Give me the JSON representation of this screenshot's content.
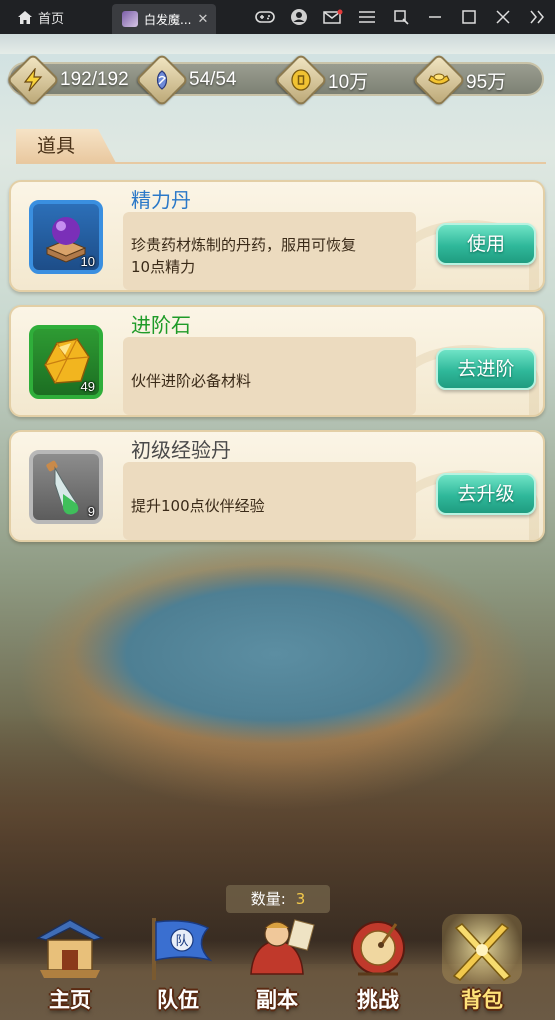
{
  "titlebar": {
    "home_label": "首页",
    "tab_title": "白发魔...",
    "tab_close": "✕",
    "tools": [
      "gamepad-icon",
      "user-icon",
      "mail-icon",
      "menu-icon",
      "screenshot-icon",
      "minimize-icon",
      "maximize-icon",
      "close-icon",
      "collapse-icon"
    ]
  },
  "resources": [
    {
      "icon": "lightning-icon",
      "value": "192/192"
    },
    {
      "icon": "spirit-icon",
      "value": "54/54"
    },
    {
      "icon": "coin-icon",
      "value": "10万"
    },
    {
      "icon": "ingot-icon",
      "value": "95万"
    }
  ],
  "section": {
    "title": "道具"
  },
  "items": [
    {
      "name": "精力丹",
      "name_color": "#2a78c8",
      "icon": "purple-orb-icon",
      "frame_color": "#3a8fe0",
      "count": "10",
      "desc_line1": "珍贵药材炼制的丹药，服用可恢复",
      "desc_line2": "10点精力",
      "action": "使用"
    },
    {
      "name": "进阶石",
      "name_color": "#1f9b28",
      "icon": "yellow-gem-icon",
      "frame_color": "#2fae3a",
      "count": "49",
      "desc_line1": "伙伴进阶必备材料",
      "desc_line2": "",
      "action": "去进阶"
    },
    {
      "name": "初级经验丹",
      "name_color": "#4a4a4a",
      "icon": "potion-bottle-icon",
      "frame_color": "#b8b8b8",
      "count": "9",
      "desc_line1": "提升100点伙伴经验",
      "desc_line2": "",
      "action": "去升级"
    }
  ],
  "quantity": {
    "label": "数量:",
    "value": "3"
  },
  "nav": [
    {
      "label": "主页",
      "icon": "palace-icon",
      "active": false
    },
    {
      "label": "队伍",
      "icon": "team-flag-icon",
      "badge": "队",
      "active": false
    },
    {
      "label": "副本",
      "icon": "warrior-icon",
      "active": false
    },
    {
      "label": "挑战",
      "icon": "drum-icon",
      "active": false
    },
    {
      "label": "背包",
      "icon": "swords-icon",
      "active": true
    }
  ]
}
